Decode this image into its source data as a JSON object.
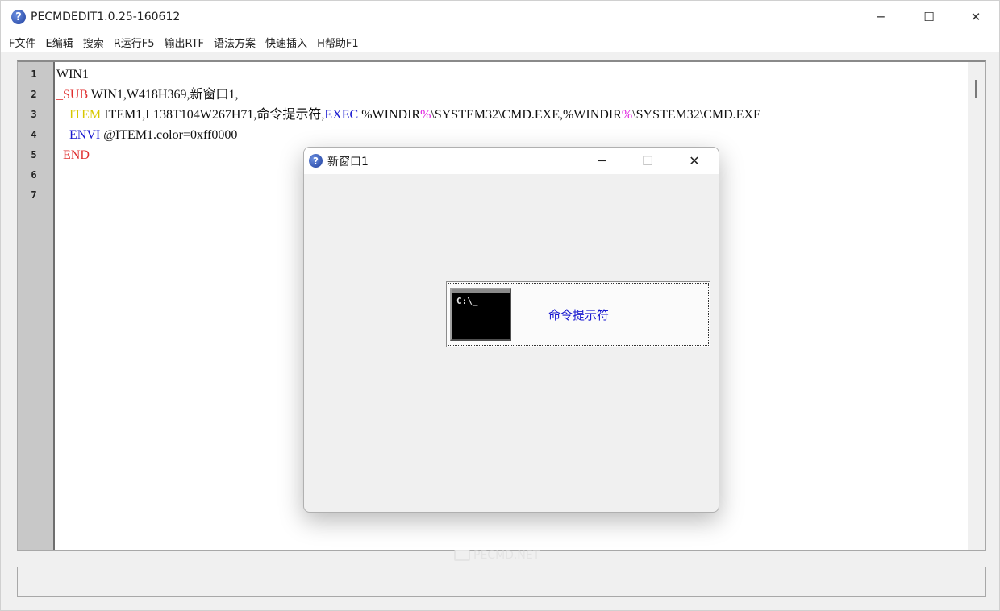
{
  "app": {
    "title": "PECMDEDIT1.0.25-160612",
    "icon": "question-icon",
    "minimize_glyph": "─",
    "maximize_glyph": "☐",
    "close_glyph": "✕"
  },
  "menu": [
    "F文件",
    "E编辑",
    "搜索",
    "R运行F5",
    "输出RTF",
    "语法方案",
    "快速插入",
    "H帮助F1"
  ],
  "editor": {
    "line_numbers": [
      "1",
      "2",
      "3",
      "4",
      "5",
      "6",
      "7"
    ],
    "lines": [
      [
        {
          "t": "WIN1",
          "c": "#111111"
        }
      ],
      [
        {
          "t": "_SUB",
          "c": "#e03030"
        },
        {
          "t": " WIN1,W418H369,新窗口1,",
          "c": "#111111"
        }
      ],
      [
        {
          "t": "    ",
          "c": "#111111"
        },
        {
          "t": "ITEM",
          "c": "#d8c800"
        },
        {
          "t": " ITEM1,L138T104W267H71,命令提示符,",
          "c": "#111111"
        },
        {
          "t": "EXEC",
          "c": "#1a1ad0"
        },
        {
          "t": " %WINDIR",
          "c": "#111111"
        },
        {
          "t": "%",
          "c": "#e020e0"
        },
        {
          "t": "\\SYSTEM32\\CMD.EXE,%WINDIR",
          "c": "#111111"
        },
        {
          "t": "%",
          "c": "#e020e0"
        },
        {
          "t": "\\SYSTEM32\\CMD.EXE",
          "c": "#111111"
        }
      ],
      [
        {
          "t": "    ",
          "c": "#111111"
        },
        {
          "t": "ENVI",
          "c": "#1a1ad0"
        },
        {
          "t": " @ITEM1.color=0xff0000",
          "c": "#111111"
        }
      ],
      [
        {
          "t": "_END",
          "c": "#e03030"
        }
      ],
      [],
      []
    ]
  },
  "watermark": "PECMD.NET",
  "dialog": {
    "title": "新窗口1",
    "icon": "question-icon",
    "minimize_glyph": "─",
    "maximize_glyph": "☐",
    "close_glyph": "✕",
    "item": {
      "label": "命令提示符",
      "icon": "cmd-prompt-icon",
      "icon_text": "C:\\_",
      "label_color": "#1a1ad0"
    }
  }
}
